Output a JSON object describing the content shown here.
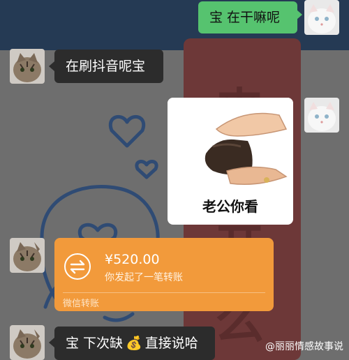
{
  "chat": {
    "messages": [
      {
        "side": "right",
        "type": "text",
        "text": "宝 在干嘛呢"
      },
      {
        "side": "left",
        "type": "text",
        "text": "在刷抖音呢宝"
      },
      {
        "side": "right",
        "type": "image",
        "caption": "老公你看"
      },
      {
        "side": "left",
        "type": "transfer",
        "amount": "¥520.00",
        "desc": "你发起了一笔转账",
        "footer": "微信转账"
      },
      {
        "side": "left",
        "type": "text",
        "text_before": "宝 下次缺",
        "emoji": "💰",
        "text_after": "直接说哈"
      }
    ]
  },
  "watermark": {
    "text": "@丽丽情感故事说"
  },
  "colors": {
    "green_bubble": "#56c36f",
    "dark_bubble": "#2c2c2c",
    "transfer": "#f29a3b",
    "top_band": "#253a54",
    "banner": "#6d3838"
  }
}
